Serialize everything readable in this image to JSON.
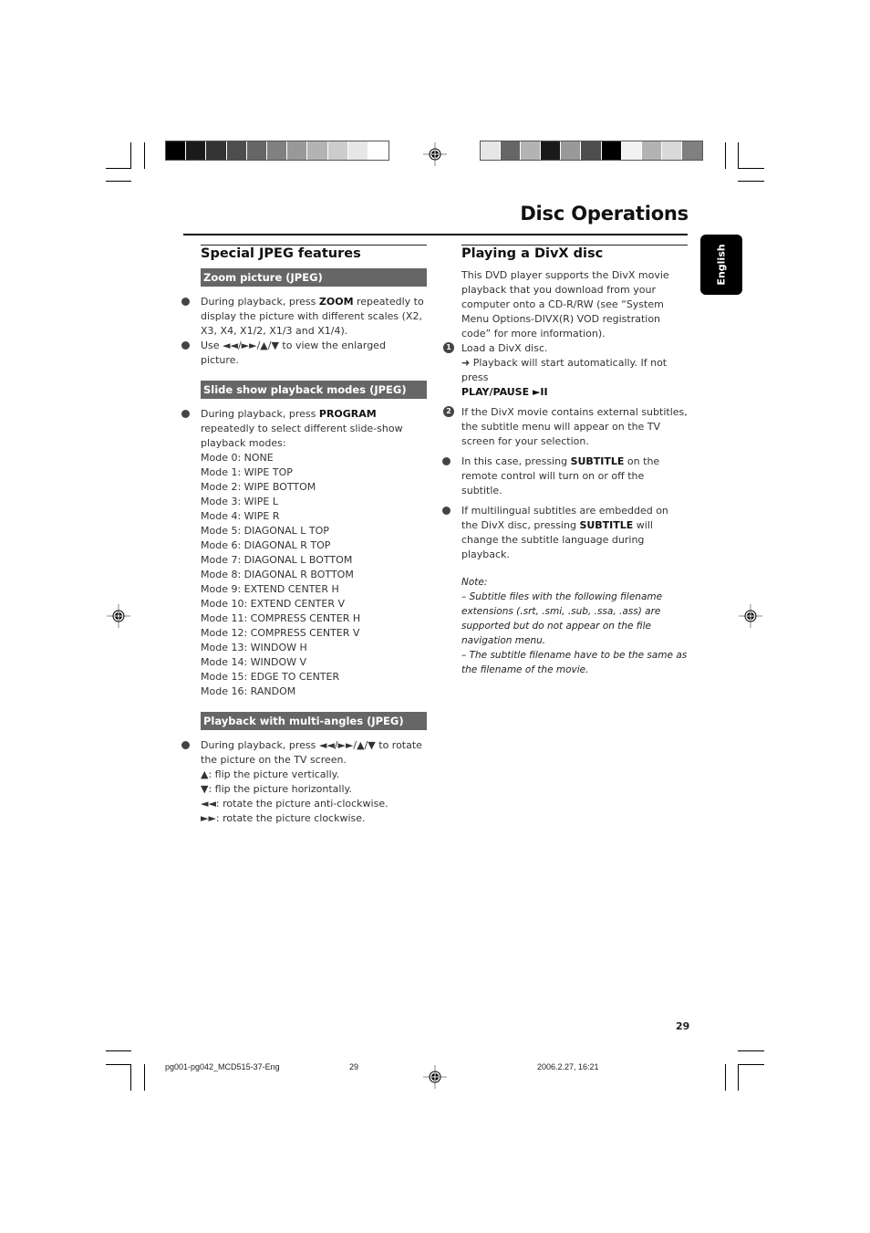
{
  "header": {
    "title": "Disc Operations",
    "language_tab": "English",
    "calibration_left": [
      "#000000",
      "#1a1a1a",
      "#333333",
      "#4d4d4d",
      "#666666",
      "#808080",
      "#999999",
      "#b3b3b3",
      "#cccccc",
      "#e6e6e6",
      "#ffffff"
    ],
    "calibration_right": [
      "#e6e6e6",
      "#666666",
      "#b3b3b3",
      "#1a1a1a",
      "#999999",
      "#4d4d4d",
      "#000000",
      "#f2f2f2",
      "#b3b3b3",
      "#d9d9d9",
      "#808080"
    ]
  },
  "left_column": {
    "section_title": "Special JPEG features",
    "zoom": {
      "heading": "Zoom picture (JPEG)",
      "bullet1_pre": "During playback, press ",
      "bullet1_bold": "ZOOM",
      "bullet1_post": " repeatedly to display the picture with different scales (X2, X3, X4, X1/2, X1/3 and X1/4).",
      "bullet2": "Use ◄◄/►►/▲/▼ to view the enlarged picture."
    },
    "slideshow": {
      "heading": "Slide show playback modes (JPEG)",
      "bullet_pre": "During playback, press ",
      "bullet_bold": "PROGRAM",
      "bullet_post": " repeatedly to select different slide-show playback modes:",
      "modes": [
        "Mode 0: NONE",
        "Mode 1: WIPE TOP",
        "Mode 2: WIPE BOTTOM",
        "Mode 3: WIPE L",
        "Mode 4: WIPE R",
        "Mode 5: DIAGONAL L TOP",
        "Mode 6: DIAGONAL R TOP",
        "Mode 7: DIAGONAL L BOTTOM",
        "Mode 8: DIAGONAL R BOTTOM",
        "Mode 9: EXTEND CENTER H",
        "Mode 10: EXTEND CENTER V",
        "Mode 11: COMPRESS CENTER H",
        "Mode 12: COMPRESS CENTER V",
        "Mode 13: WINDOW H",
        "Mode 14: WINDOW V",
        "Mode 15: EDGE TO CENTER",
        "Mode 16:  RANDOM"
      ]
    },
    "multiangle": {
      "heading": "Playback with multi-angles (JPEG)",
      "bullet": "During playback, press ◄◄/►►/▲/▼  to rotate the picture on the TV screen.",
      "lines": [
        "▲: flip the picture vertically.",
        "▼: flip the picture horizontally.",
        "◄◄:  rotate the picture anti-clockwise.",
        "►►:  rotate the picture clockwise."
      ]
    }
  },
  "right_column": {
    "section_title": "Playing a DivX disc",
    "intro": "This DVD player supports the DivX movie playback that you download from your computer onto a CD-R/RW (see “System Menu Options-DIVX(R) VOD registration code” for more information).",
    "step1_num": "1",
    "step1": "Load a DivX disc.",
    "step1_result": "➜ Playback will start automatically. If not press",
    "step1_button": "PLAY/PAUSE ►II",
    "step2_num": "2",
    "step2": "If the DivX movie contains external subtitles, the subtitle menu will appear on the TV screen for your selection.",
    "bullet1_pre": "In this case, pressing ",
    "bullet1_bold": "SUBTITLE",
    "bullet1_post": " on the remote control will turn on or off the subtitle.",
    "bullet2_pre": "If multilingual subtitles are embedded on the DivX disc, pressing ",
    "bullet2_bold": "SUBTITLE",
    "bullet2_post": " will change the subtitle language during playback.",
    "note_label": "Note:",
    "note1": "–  Subtitle files with the following filename extensions (.srt, .smi, .sub, .ssa, .ass) are supported but do not appear on the file navigation menu.",
    "note2": "–  The subtitle filename have to be the same as the filename of the movie."
  },
  "page_number": "29",
  "footer": {
    "file": "pg001-pg042_MCD515-37-Eng",
    "page": "29",
    "datetime": "2006.2.27, 16:21"
  }
}
